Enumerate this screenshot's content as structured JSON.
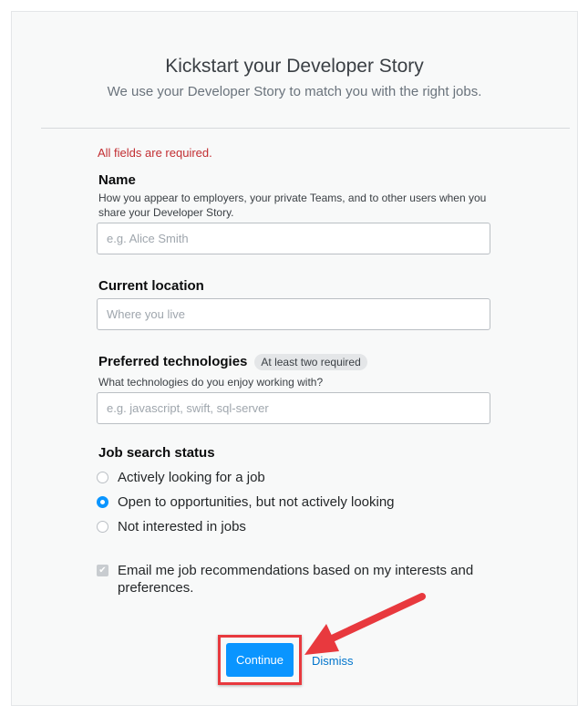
{
  "header": {
    "title": "Kickstart your Developer Story",
    "subtitle": "We use your Developer Story to match you with the right jobs."
  },
  "form": {
    "required_note": "All fields are required.",
    "name": {
      "label": "Name",
      "description": "How you appear to employers, your private Teams, and to other users when you share your Developer Story.",
      "placeholder": "e.g. Alice Smith"
    },
    "location": {
      "label": "Current location",
      "placeholder": "Where you live"
    },
    "technologies": {
      "label": "Preferred technologies",
      "badge": "At least two required",
      "description": "What technologies do you enjoy working with?",
      "placeholder": "e.g. javascript, swift, sql-server"
    },
    "job_status": {
      "label": "Job search status",
      "options": [
        {
          "label": "Actively looking for a job",
          "selected": false
        },
        {
          "label": "Open to opportunities, but not actively looking",
          "selected": true
        },
        {
          "label": "Not interested in jobs",
          "selected": false
        }
      ]
    },
    "email_opt_in": {
      "label": "Email me job recommendations based on my interests and preferences.",
      "checked": true
    }
  },
  "actions": {
    "continue": "Continue",
    "dismiss": "Dismiss"
  },
  "colors": {
    "primary": "#0a95ff",
    "annotation": "#e8393e",
    "error": "#c22e32"
  }
}
